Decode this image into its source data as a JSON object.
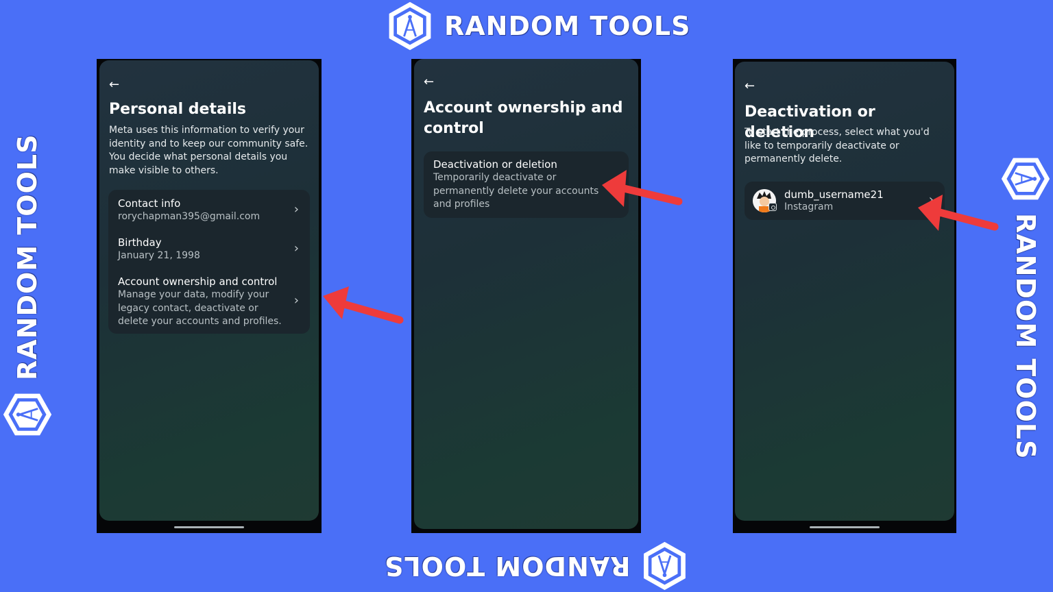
{
  "brand": {
    "name": "RANDOM TOOLS"
  },
  "colors": {
    "background": "#4a6ff7",
    "arrow": "#ee3b3b",
    "card": "#1b262d"
  },
  "screen1": {
    "back_icon": "←",
    "title": "Personal details",
    "description": "Meta uses this information to verify your identity and to keep our community safe. You decide what personal details you make visible to others.",
    "items": [
      {
        "label": "Contact info",
        "sub": "rorychapman395@gmail.com"
      },
      {
        "label": "Birthday",
        "sub": "January 21, 1998"
      },
      {
        "label": "Account ownership and control",
        "sub": "Manage your data, modify your legacy contact, deactivate or delete your accounts and profiles."
      }
    ]
  },
  "screen2": {
    "back_icon": "←",
    "title": "Account ownership and control",
    "items": [
      {
        "label": "Deactivation or deletion",
        "sub": "Temporarily deactivate or permanently delete your accounts and profiles"
      }
    ]
  },
  "screen3": {
    "back_icon": "←",
    "title": "Deactivation or deletion",
    "description": "To start the process, select what you'd like to temporarily deactivate or permanently delete.",
    "account": {
      "username": "dumb_username21",
      "platform": "Instagram"
    }
  },
  "icons": {
    "chevron": "›",
    "compass": "compass-icon",
    "instagram": "instagram-icon",
    "arrow": "red-arrow-icon"
  }
}
